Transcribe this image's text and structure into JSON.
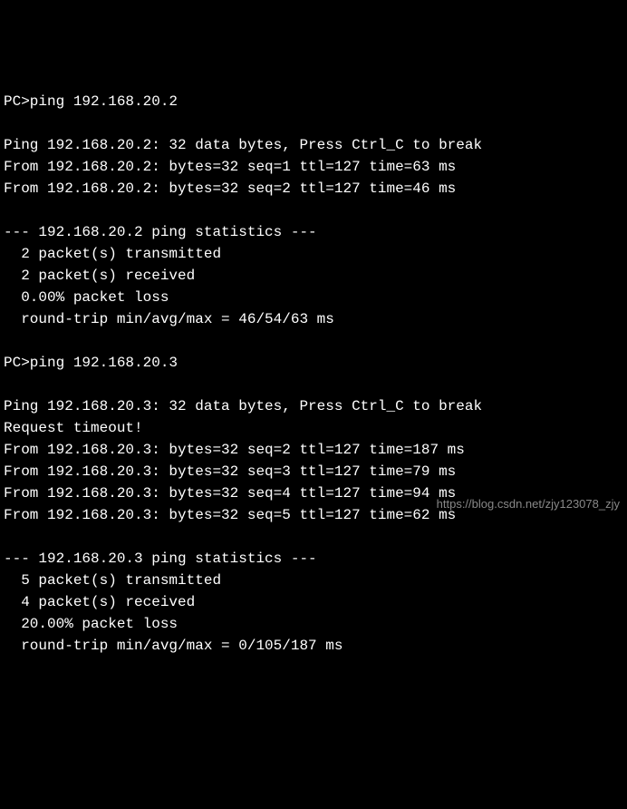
{
  "terminal": {
    "lines": [
      "PC>ping 192.168.20.2",
      "",
      "Ping 192.168.20.2: 32 data bytes, Press Ctrl_C to break",
      "From 192.168.20.2: bytes=32 seq=1 ttl=127 time=63 ms",
      "From 192.168.20.2: bytes=32 seq=2 ttl=127 time=46 ms",
      "",
      "--- 192.168.20.2 ping statistics ---",
      "  2 packet(s) transmitted",
      "  2 packet(s) received",
      "  0.00% packet loss",
      "  round-trip min/avg/max = 46/54/63 ms",
      "",
      "PC>ping 192.168.20.3",
      "",
      "Ping 192.168.20.3: 32 data bytes, Press Ctrl_C to break",
      "Request timeout!",
      "From 192.168.20.3: bytes=32 seq=2 ttl=127 time=187 ms",
      "From 192.168.20.3: bytes=32 seq=3 ttl=127 time=79 ms",
      "From 192.168.20.3: bytes=32 seq=4 ttl=127 time=94 ms",
      "From 192.168.20.3: bytes=32 seq=5 ttl=127 time=62 ms",
      "",
      "--- 192.168.20.3 ping statistics ---",
      "  5 packet(s) transmitted",
      "  4 packet(s) received",
      "  20.00% packet loss",
      "  round-trip min/avg/max = 0/105/187 ms"
    ]
  },
  "watermark": {
    "text": "https://blog.csdn.net/zjy123078_zjy"
  }
}
